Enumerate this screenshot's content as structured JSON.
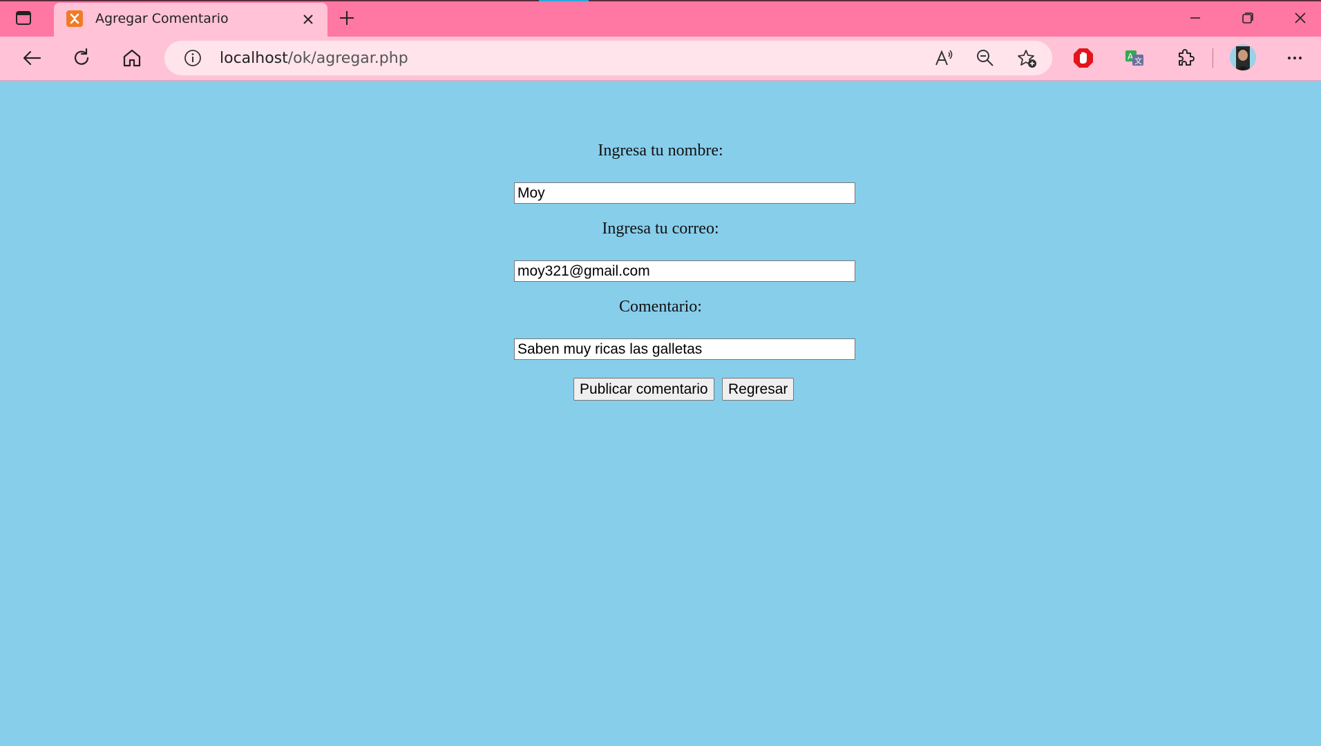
{
  "browser": {
    "tab_title": "Agregar Comentario",
    "url_host": "localhost",
    "url_path": "/ok/agregar.php",
    "accent_color": "#ff77a3",
    "toolbar_color": "#ffc2d6"
  },
  "icons": {
    "sidebar": "tab-actions-icon",
    "favicon": "xampp-icon",
    "read_aloud": "read-aloud-icon",
    "zoom": "zoom-out-icon",
    "favorite": "add-favorite-icon",
    "adblock": "adblock-icon",
    "translate": "translate-icon",
    "extensions": "extensions-icon",
    "menu": "more-icon"
  },
  "form": {
    "name_label": "Ingresa tu nombre:",
    "name_value": "Moy",
    "email_label": "Ingresa tu correo:",
    "email_value": "moy321@gmail.com",
    "comment_label": "Comentario:",
    "comment_value": "Saben muy ricas las galletas",
    "submit_label": "Publicar comentario",
    "back_label": "Regresar"
  },
  "page": {
    "background": "#87ceeb"
  }
}
